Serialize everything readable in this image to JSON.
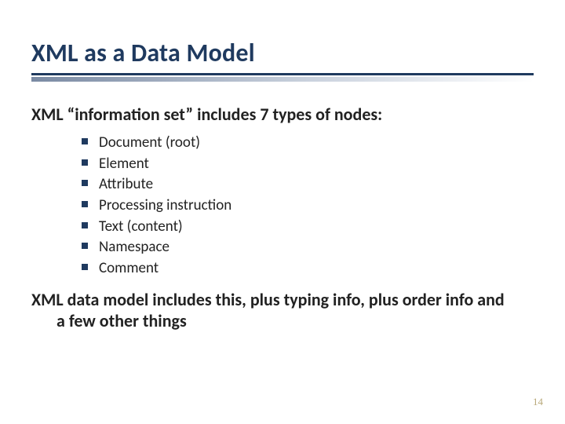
{
  "title": "XML as a Data Model",
  "lead": "XML “information set” includes 7 types of nodes:",
  "bullets": [
    "Document (root)",
    "Element",
    "Attribute",
    "Processing instruction",
    "Text (content)",
    "Namespace",
    "Comment"
  ],
  "closing": "XML data model includes this, plus typing info, plus order info and a few other things",
  "page_number": "14"
}
